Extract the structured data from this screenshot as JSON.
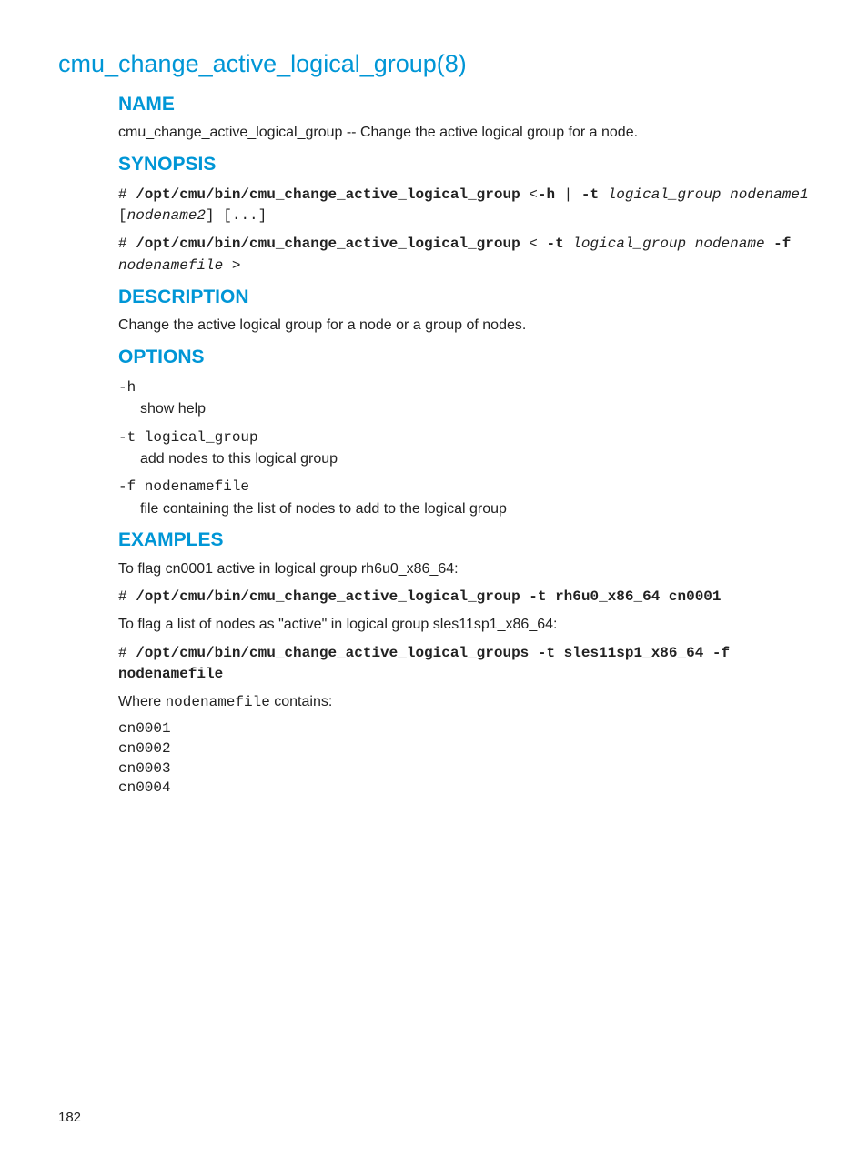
{
  "title": "cmu_change_active_logical_group(8)",
  "sections": {
    "name": {
      "heading": "NAME",
      "text": "cmu_change_active_logical_group -- Change the active logical group for a node."
    },
    "synopsis": {
      "heading": "SYNOPSIS",
      "line1": {
        "prompt": "# ",
        "cmd": "/opt/cmu/bin/cmu_change_active_logical_group",
        "lt": " <",
        "opt_h": "-h",
        "pipe": " | ",
        "opt_t": "-t",
        "sp": " ",
        "arg_lg": "logical_group",
        "arg_n1": "nodename1",
        "sp2": " ",
        "lb": "[",
        "arg_n2": "nodename2",
        "rb": "]",
        "sp3": " ",
        "ellipsis": "[...]"
      },
      "line2": {
        "prompt": "# ",
        "cmd": "/opt/cmu/bin/cmu_change_active_logical_group",
        "lt": " < ",
        "opt_t": "-t",
        "sp": " ",
        "arg_lg": "logical_group",
        "sp2": " ",
        "arg_nn": "nodename",
        "opt_f": "-f",
        "sp3": " ",
        "arg_nf": "nodenamefile",
        "gt": " >"
      }
    },
    "description": {
      "heading": "DESCRIPTION",
      "text": "Change the active logical group for a node or a group of nodes."
    },
    "options": {
      "heading": "OPTIONS",
      "items": [
        {
          "term": "-h",
          "def": "show help"
        },
        {
          "term": "-t logical_group",
          "def": "add nodes to this logical group"
        },
        {
          "term": "-f nodenamefile",
          "def": "file containing the list of nodes to add to the logical group"
        }
      ]
    },
    "examples": {
      "heading": "EXAMPLES",
      "intro1": "To flag cn0001 active in logical group rh6u0_x86_64:",
      "cmd1": {
        "prompt": "# ",
        "cmd": "/opt/cmu/bin/cmu_change_active_logical_group -t rh6u0_x86_64 cn0001"
      },
      "intro2": "To flag a list of nodes as \"active\" in logical group sles11sp1_x86_64:",
      "cmd2": {
        "prompt": "# ",
        "cmd": "/opt/cmu/bin/cmu_change_active_logical_groups -t sles11sp1_x86_64 -f nodenamefile"
      },
      "where_pre": "Where ",
      "where_code": "nodenamefile",
      "where_post": " contains:",
      "file_contents": "cn0001\ncn0002\ncn0003\ncn0004"
    }
  },
  "page_number": "182"
}
